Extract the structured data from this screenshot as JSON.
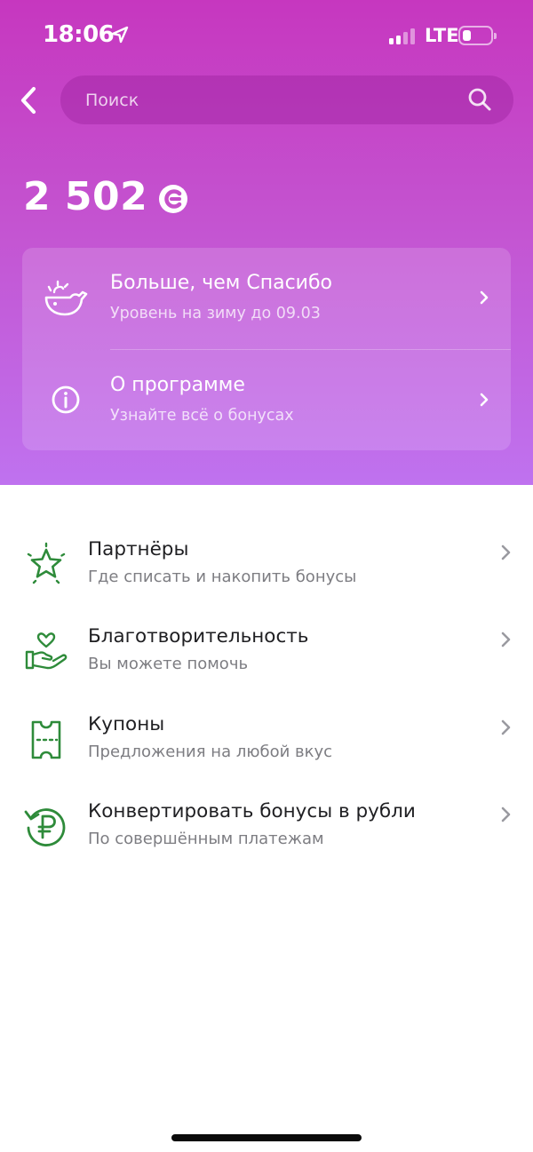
{
  "status_bar": {
    "time": "18:06",
    "network": "LTE",
    "icons": [
      "location-arrow-icon",
      "signal-icon",
      "battery-icon"
    ]
  },
  "header": {
    "back_icon": "chevron-left-icon",
    "search": {
      "placeholder": "Поиск",
      "icon": "search-icon"
    }
  },
  "balance": {
    "value": "2 502",
    "icon": "bonus-coin-icon"
  },
  "hero_card": {
    "items": [
      {
        "title": "Больше, чем Спасибо",
        "subtitle": "Уровень на зиму до 09.03",
        "icon": "whale-icon"
      },
      {
        "title": "О программе",
        "subtitle": "Узнайте всё о бонусах",
        "icon": "info-icon"
      }
    ]
  },
  "menu": {
    "items": [
      {
        "title": "Партнёры",
        "subtitle": "Где списать и накопить бонусы",
        "icon": "star-icon"
      },
      {
        "title": "Благотворительность",
        "subtitle": "Вы можете помочь",
        "icon": "heart-hand-icon"
      },
      {
        "title": "Купоны",
        "subtitle": "Предложения на любой вкус",
        "icon": "coupon-icon"
      },
      {
        "title": "Конвертировать бонусы в рубли",
        "subtitle": "По совершённым платежам",
        "icon": "ruble-convert-icon"
      }
    ]
  },
  "colors": {
    "hero_top": "#c637bf",
    "hero_bottom": "#bf72ef",
    "icon_green": "#2e8b3a",
    "text_primary": "#1f1f22",
    "text_secondary": "#7d7d82"
  }
}
